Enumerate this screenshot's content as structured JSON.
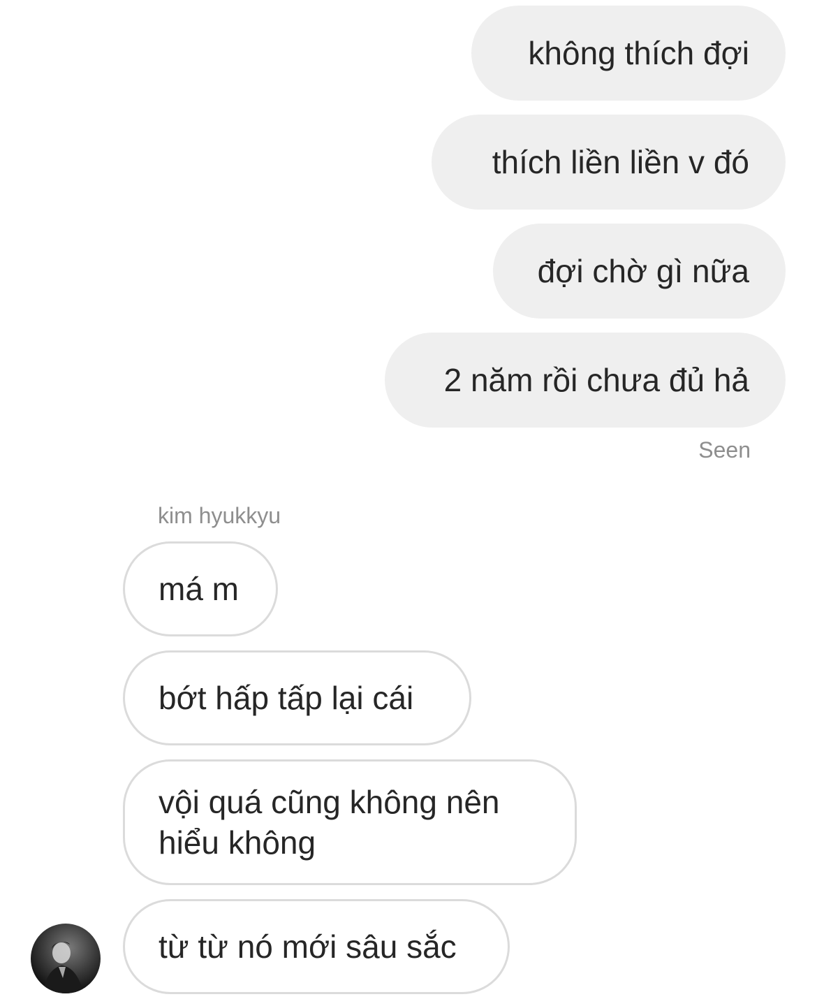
{
  "conversation": {
    "sent_messages": [
      {
        "text": "không thích đợi"
      },
      {
        "text": "thích liền liền v đó"
      },
      {
        "text": "đợi chờ gì nữa"
      },
      {
        "text": "2 năm rồi chưa đủ hả"
      }
    ],
    "seen_label": "Seen",
    "other_user": {
      "name": "kim hyukkyu",
      "avatar_icon": "person-photo-icon"
    },
    "received_messages": [
      {
        "text": "má m"
      },
      {
        "text": "bớt hấp tấp lại cái"
      },
      {
        "text": "vội quá cũng không nên hiểu không"
      },
      {
        "text": "từ từ nó mới sâu sắc"
      }
    ]
  }
}
